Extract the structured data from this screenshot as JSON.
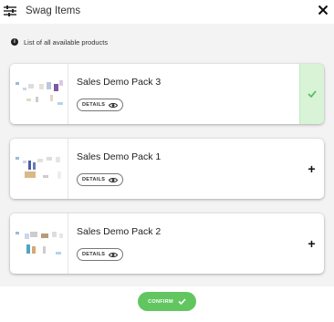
{
  "header": {
    "title": "Swag Items",
    "filter_icon": "sliders-icon",
    "close_icon": "close-icon"
  },
  "info": {
    "text": "List of all available products",
    "icon": "info-icon"
  },
  "products": [
    {
      "title": "Sales Demo Pack 3",
      "details_label": "DETAILS",
      "state": "selected"
    },
    {
      "title": "Sales Demo Pack 1",
      "details_label": "DETAILS",
      "state": "add",
      "action_symbol": "+"
    },
    {
      "title": "Sales Demo Pack 2",
      "details_label": "DETAILS",
      "state": "add",
      "action_symbol": "+"
    }
  ],
  "footer": {
    "confirm_label": "CONFIRM"
  },
  "colors": {
    "accent_green": "#61c65f",
    "selected_bg": "#d8f3d6",
    "check_green": "#5fbf5c"
  }
}
